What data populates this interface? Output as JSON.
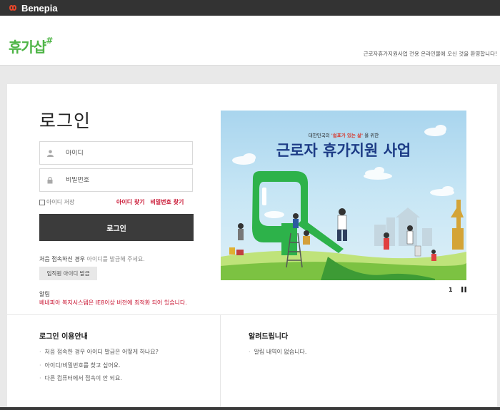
{
  "topbar": {
    "brand": "Benepia",
    "brand_color": "#e8462a"
  },
  "header": {
    "logo_text": "휴가샵",
    "logo_hash": "#",
    "welcome": "근로자휴가지원사업 전용 온라인몰에 오신 것을 환영합니다!"
  },
  "login": {
    "title": "로그인",
    "id_placeholder": "아이디",
    "pw_placeholder": "비밀번호",
    "save_id_label": "아이디 저장",
    "find_id": "아이디 찾기",
    "find_pw": "비밀번호 찾기",
    "login_button": "로그인",
    "first_visit_prefix": "처음 접속하신 경우",
    "first_visit_suffix": "아이디를 발급해 주세요.",
    "issue_button": "임직원 아이디 발급",
    "notice_label": "알림",
    "notice_text": "베네피아 복지시스템은 IE8이상 버전에 최적화 되어 있습니다."
  },
  "banner": {
    "subtitle_prefix": "대한민국의",
    "subtitle_highlight": "'쉼표가 있는 삶'",
    "subtitle_suffix": "을 위한",
    "headline": "근로자 휴가지원 사업",
    "page_number": "1",
    "pause_icon": "pause-icon"
  },
  "guide": {
    "title": "로그인 이용안내",
    "items": [
      "처음 접속한 경우 아이디 발급은 어떻게 하나요?",
      "아이디/비밀번호를 찾고 싶어요.",
      "다른 컴퓨터에서 접속이 안 되요."
    ]
  },
  "notices": {
    "title": "알려드립니다",
    "items": [
      "알림 내역이 없습니다."
    ]
  },
  "colors": {
    "accent_red": "#c8102e",
    "logo_green": "#4fb547",
    "button_dark": "#3b3b3b",
    "topbar": "#333333"
  }
}
